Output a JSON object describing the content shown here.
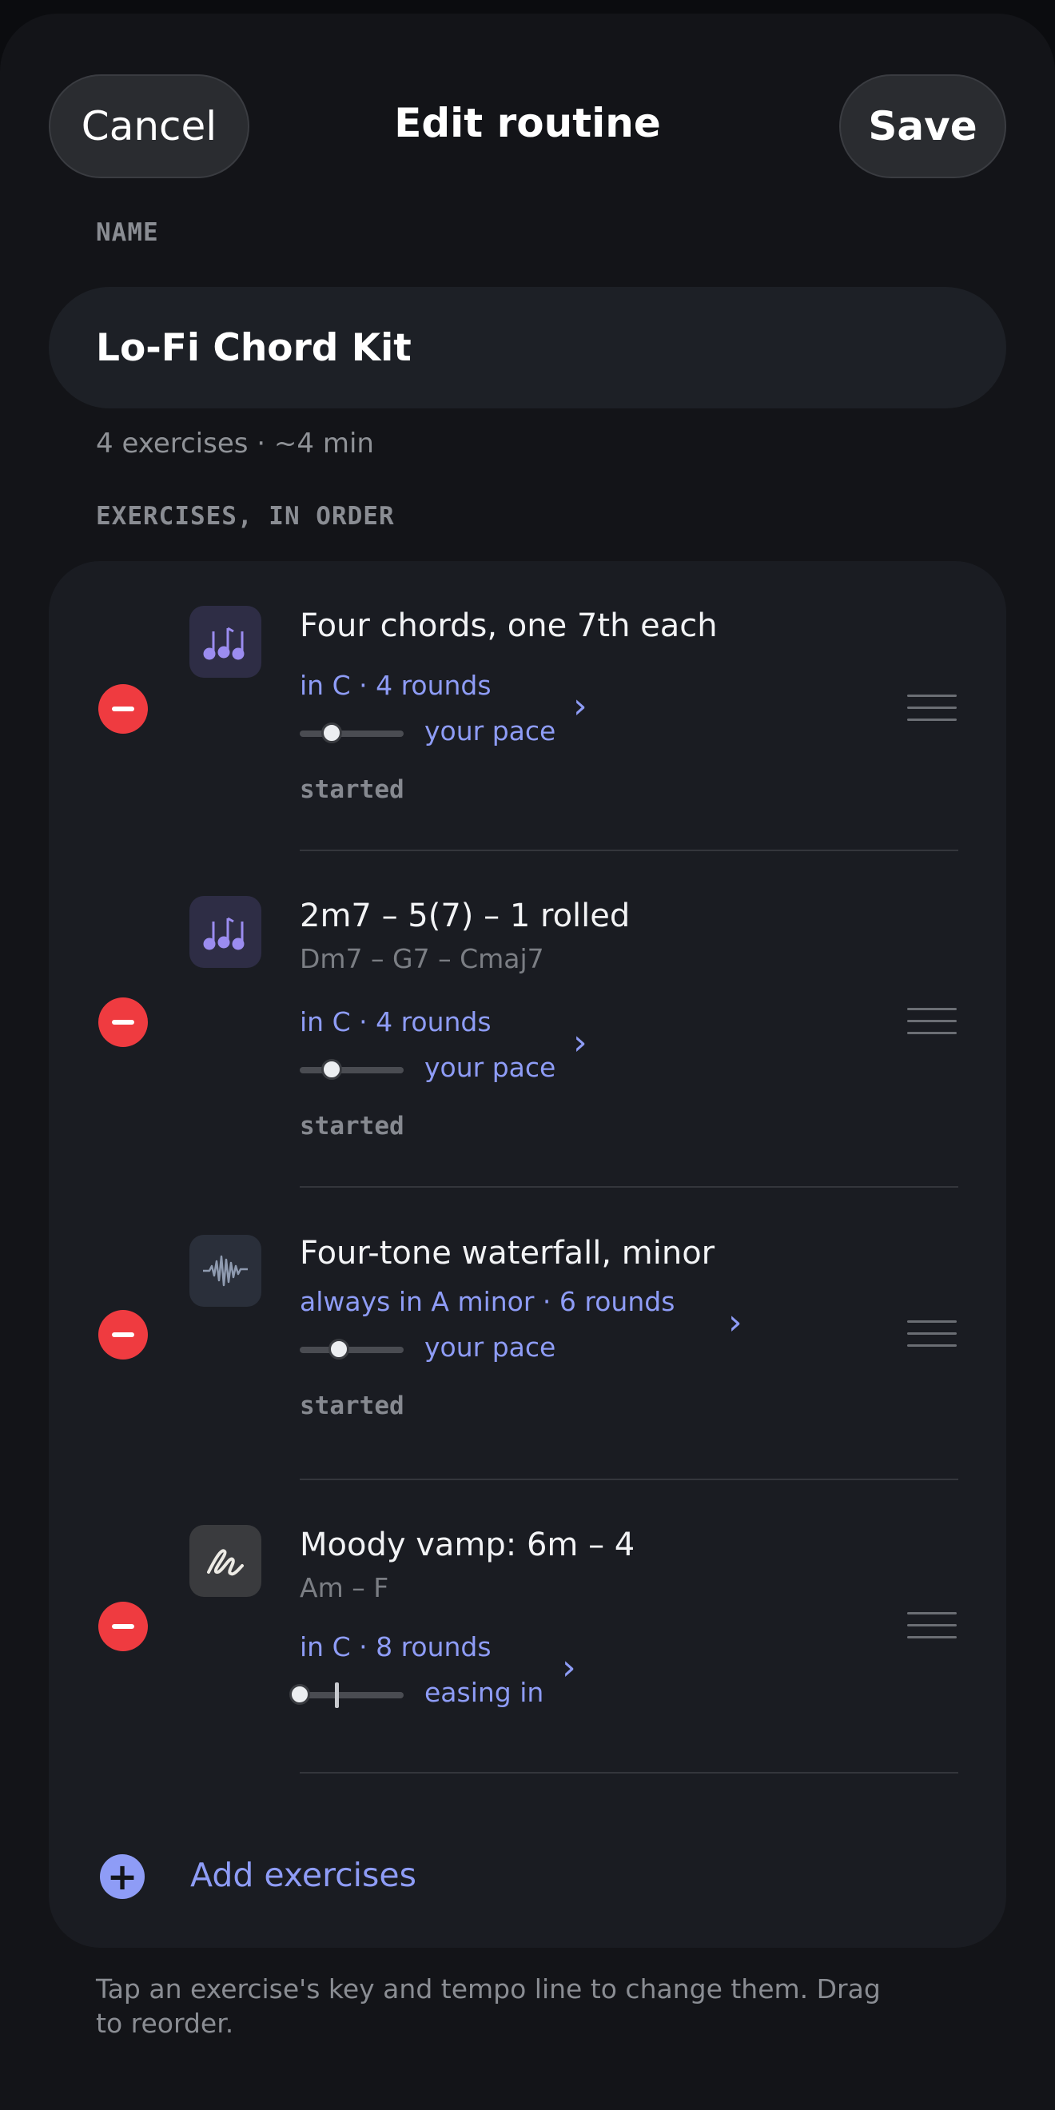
{
  "header": {
    "cancel_label": "Cancel",
    "title": "Edit routine",
    "save_label": "Save"
  },
  "name_section": {
    "label": "NAME",
    "value": "Lo-Fi Chord Kit",
    "summary": "4 exercises · ~4 min"
  },
  "exercises_section": {
    "label": "EXERCISES, IN ORDER",
    "items": [
      {
        "title": "Four chords, one 7th each",
        "subtitle": "",
        "key_rounds": "in C · 4 rounds",
        "pace": "your pace",
        "status": "started",
        "icon": "music-notes-icon",
        "tempo_level": 0.31
      },
      {
        "title": "2m7 – 5(7) – 1 rolled",
        "subtitle": "Dm7 – G7 – Cmaj7",
        "key_rounds": "in C · 4 rounds",
        "pace": "your pace",
        "status": "started",
        "icon": "music-notes-icon",
        "tempo_level": 0.31
      },
      {
        "title": "Four-tone waterfall, minor",
        "subtitle": "",
        "key_rounds": "always in A minor · 6 rounds",
        "pace": "your pace",
        "status": "started",
        "icon": "waveform-icon",
        "tempo_level": 0.38
      },
      {
        "title": "Moody vamp: 6m – 4",
        "subtitle": "Am – F",
        "key_rounds": "in C · 8 rounds",
        "pace": "easing in",
        "status": "",
        "icon": "squiggle-icon",
        "tempo_level": 0.0
      }
    ],
    "add_label": "Add exercises"
  },
  "footnote": "Tap an exercise's key and tempo line to change them. Drag to reorder.",
  "colors": {
    "accent": "#8e9cf6",
    "remove": "#ef3b40",
    "background": "#131418",
    "card": "#1a1c22"
  }
}
